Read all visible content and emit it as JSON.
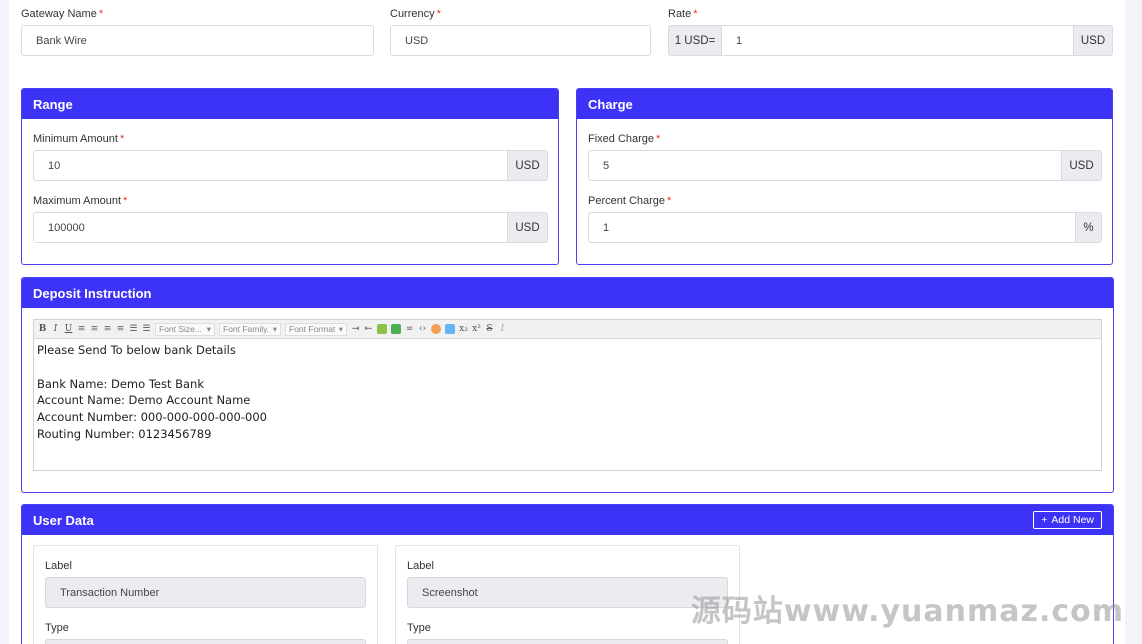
{
  "gateway": {
    "name_label": "Gateway Name",
    "name_value": "Bank Wire",
    "currency_label": "Currency",
    "currency_value": "USD",
    "rate_label": "Rate",
    "rate_prefix": "1 USD=",
    "rate_value": "1",
    "rate_suffix": "USD",
    "required_mark": "*"
  },
  "range": {
    "title": "Range",
    "min_label": "Minimum Amount",
    "min_value": "10",
    "min_suffix": "USD",
    "max_label": "Maximum Amount",
    "max_value": "100000",
    "max_suffix": "USD"
  },
  "charge": {
    "title": "Charge",
    "fixed_label": "Fixed Charge",
    "fixed_value": "5",
    "fixed_suffix": "USD",
    "percent_label": "Percent Charge",
    "percent_value": "1",
    "percent_suffix": "%"
  },
  "deposit": {
    "title": "Deposit Instruction",
    "toolbar": {
      "font_size": "Font Size...",
      "font_family": "Font Family.",
      "font_format": "Font Format"
    },
    "lines": [
      "Please Send To below bank Details",
      "",
      "Bank Name: Demo Test Bank",
      "Account Name: Demo Account Name",
      "Account Number: 000-000-000-000-000",
      "Routing Number: 0123456789"
    ]
  },
  "user_data": {
    "title": "User Data",
    "add_new": "Add New",
    "items": [
      {
        "label_caption": "Label",
        "label_value": "Transaction Number",
        "type_caption": "Type"
      },
      {
        "label_caption": "Label",
        "label_value": "Screenshot",
        "type_caption": "Type"
      }
    ]
  },
  "watermark": "源码站www.yuanmaz.com",
  "colors": {
    "accent": "#3d33f7",
    "required": "#e3342f"
  }
}
